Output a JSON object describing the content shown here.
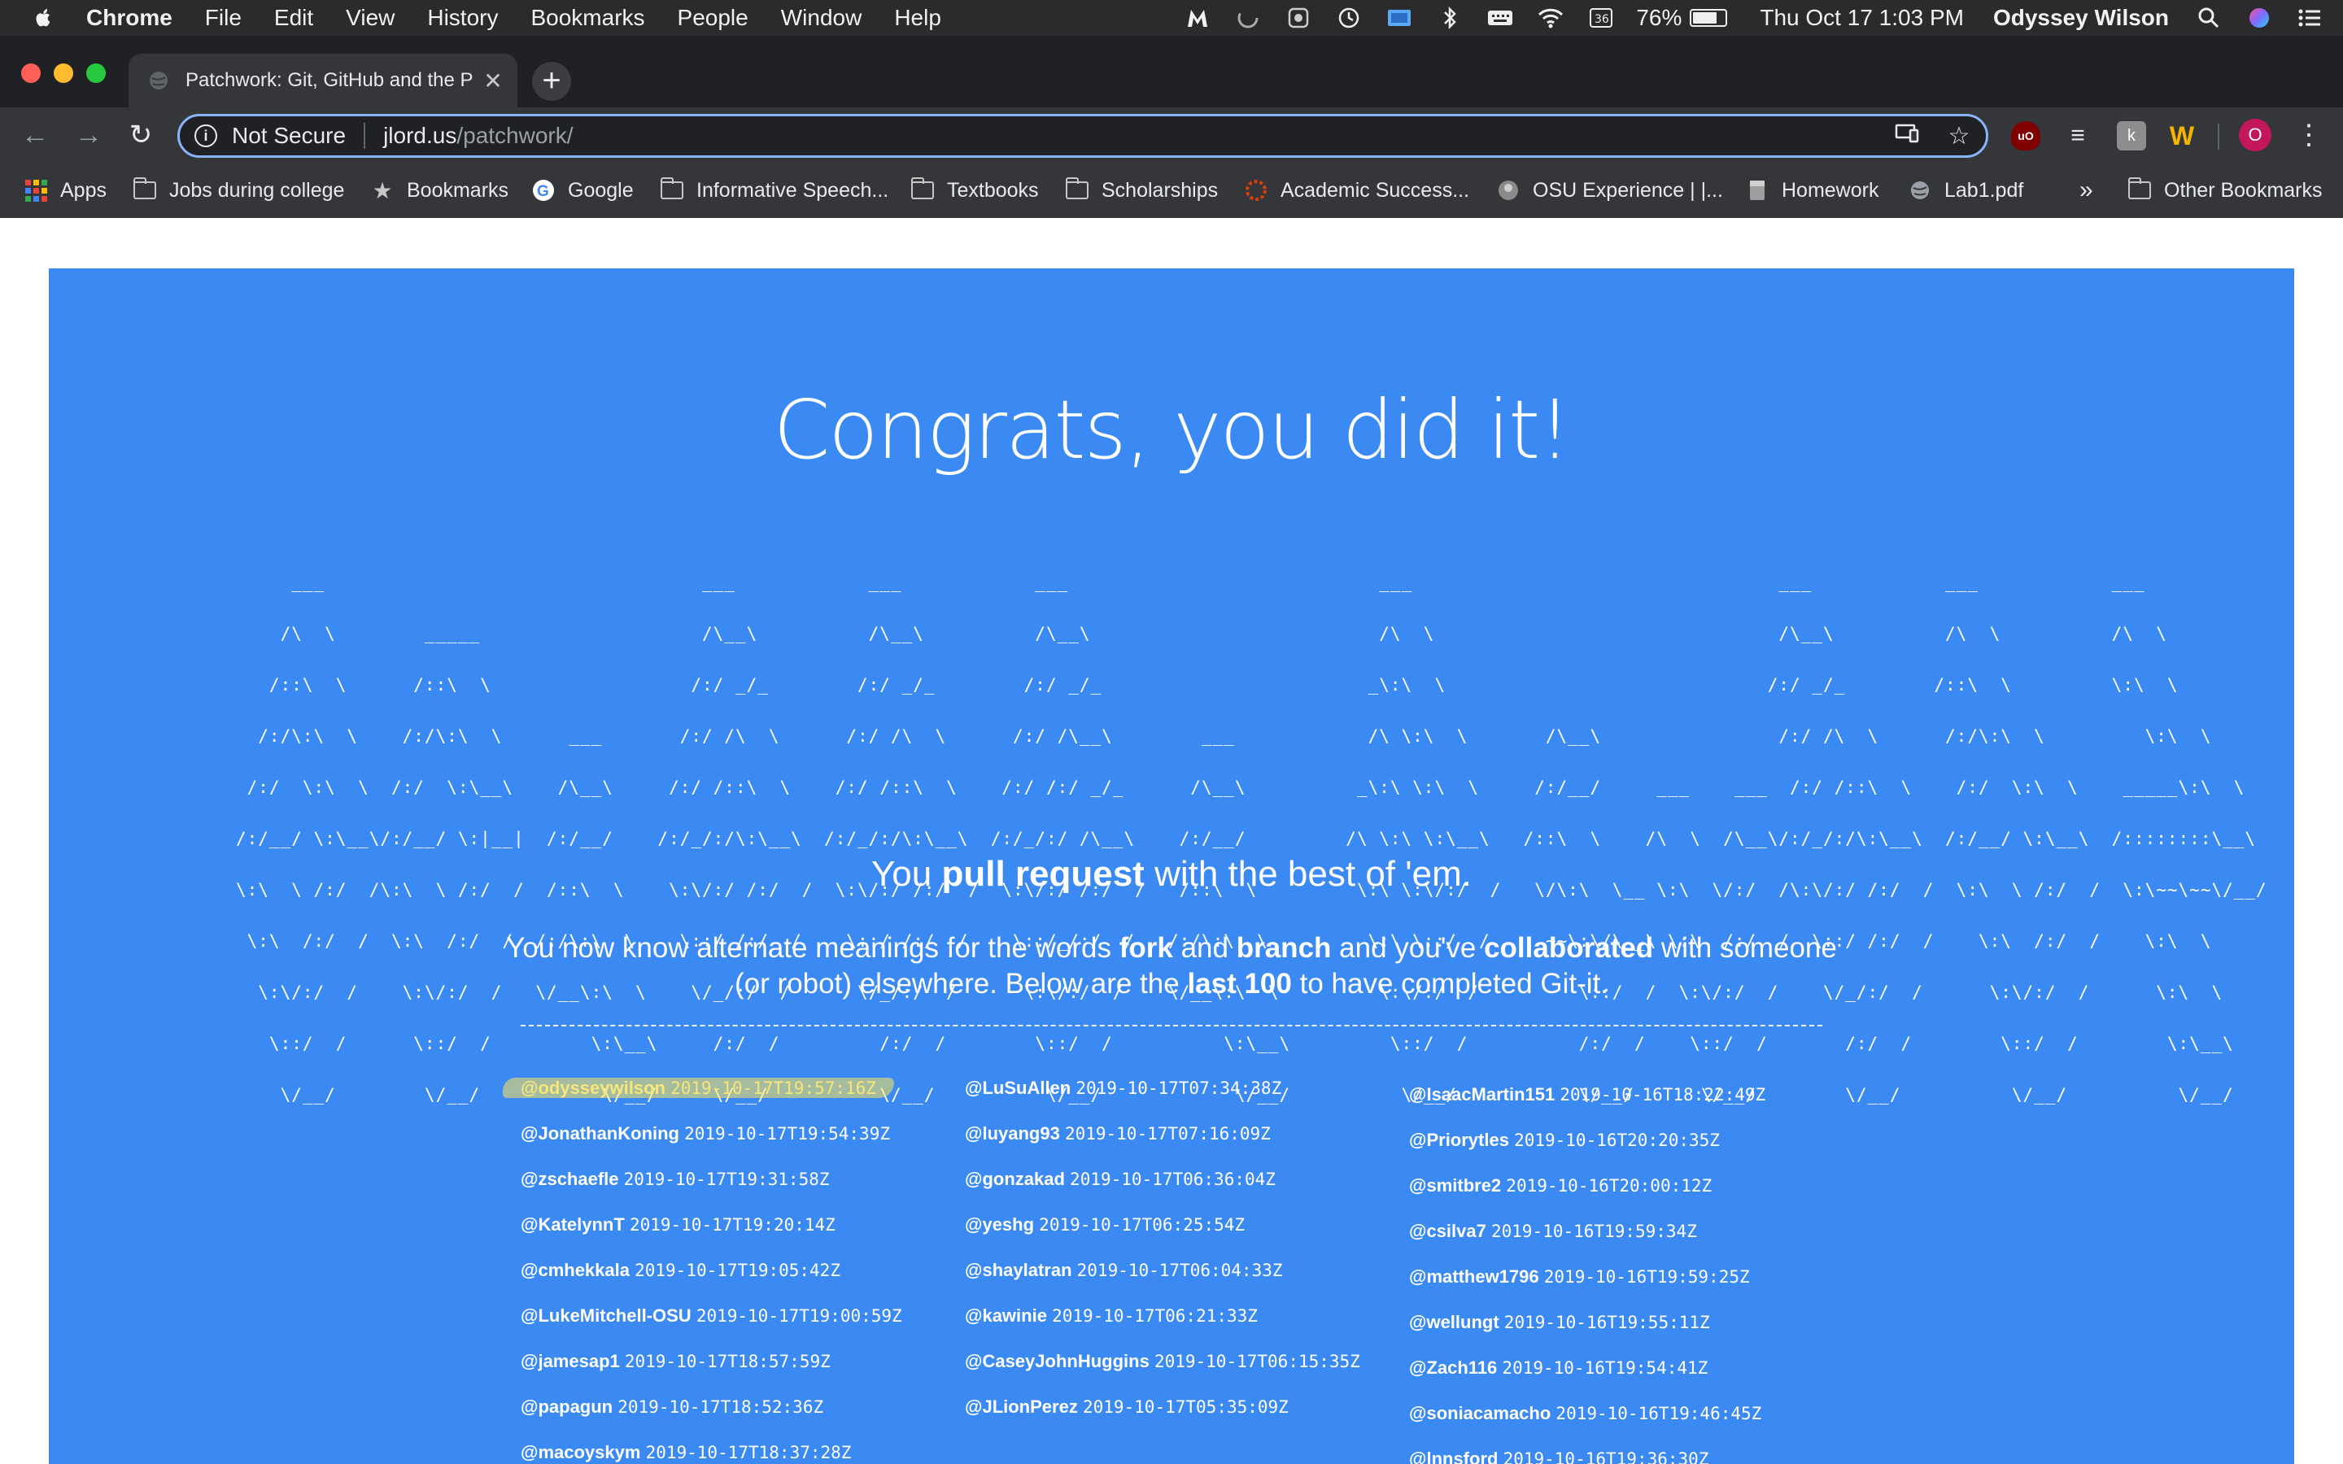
{
  "menubar": {
    "app_name": "Chrome",
    "menus": [
      "File",
      "Edit",
      "View",
      "History",
      "Bookmarks",
      "People",
      "Window",
      "Help"
    ],
    "battery": "76%",
    "battery_level": 0.76,
    "datetime": "Thu Oct 17  1:03 PM",
    "user": "Odyssey Wilson"
  },
  "browser": {
    "tab_title": "Patchwork: Git, GitHub and the P",
    "url_security": "Not Secure",
    "url_host": "jlord.us",
    "url_path": "/patchwork/",
    "profile_initial": "O",
    "ext_k": "k"
  },
  "bookmarks": {
    "items": [
      {
        "label": "Apps",
        "icon": "apps-grid-icon"
      },
      {
        "label": "Jobs during college",
        "icon": "folder-icon"
      },
      {
        "label": "Bookmarks",
        "icon": "star-icon"
      },
      {
        "label": "Google",
        "icon": "google-icon"
      },
      {
        "label": "Informative Speech...",
        "icon": "folder-icon"
      },
      {
        "label": "Textbooks",
        "icon": "folder-icon"
      },
      {
        "label": "Scholarships",
        "icon": "folder-icon"
      },
      {
        "label": "Academic Success...",
        "icon": "osu-icon"
      },
      {
        "label": "OSU Experience | |...",
        "icon": "osu-experience-icon"
      },
      {
        "label": "Homework",
        "icon": "document-icon"
      },
      {
        "label": "Lab1.pdf",
        "icon": "globe-icon"
      }
    ],
    "overflow": "»",
    "other": "Other Bookmarks"
  },
  "page": {
    "headline": "Congrats, you did it!",
    "ascii_art": [
      "     ___                                  ___            ___            ___                            ___                                 ___            ___            ___     ",
      "    /\\  \\        _____                    /\\__\\          /\\__\\          /\\__\\                          /\\  \\                               /\\__\\          /\\  \\          /\\  \\    ",
      "   /::\\  \\      /::\\  \\                  /:/ _/_        /:/ _/_        /:/ _/_                        _\\:\\  \\                             /:/ _/_        /::\\  \\         \\:\\  \\   ",
      "  /:/\\:\\  \\    /:/\\:\\  \\      ___       /:/ /\\  \\      /:/ /\\  \\      /:/ /\\__\\        ___            /\\ \\:\\  \\       /\\__\\                /:/ /\\  \\      /:/\\:\\  \\         \\:\\  \\  ",
      " /:/  \\:\\  \\  /:/  \\:\\__\\    /\\__\\     /:/ /::\\  \\    /:/ /::\\  \\    /:/ /:/ _/_      /\\__\\          _\\:\\ \\:\\  \\     /:/__/     ___    ___  /:/ /::\\  \\    /:/  \\:\\  \\    _____\\:\\  \\ ",
      "/:/__/ \\:\\__\\/:/__/ \\:|__|  /:/__/    /:/_/:/\\:\\__\\  /:/_/:/\\:\\__\\  /:/_/:/ /\\__\\    /:/__/         /\\ \\:\\ \\:\\__\\   /::\\  \\    /\\  \\  /\\__\\/:/_/:/\\:\\__\\  /:/__/ \\:\\__\\  /::::::::\\__\\",
      "\\:\\  \\ /:/  /\\:\\  \\ /:/  /  /::\\  \\    \\:\\/:/ /:/  /  \\:\\/:/ /:/  /  \\:\\/:/ /:/  /   /::\\  \\         \\:\\ \\:\\/:/  /   \\/\\:\\  \\__ \\:\\  \\/:/  /\\:\\/:/ /:/  /  \\:\\  \\ /:/  /  \\:\\~~\\~~\\/__/",
      " \\:\\  /:/  /  \\:\\  /:/  /  /:/\\:\\  \\    \\::/ /:/  /    \\::/ /:/  /    \\::/_/:/  /   /:/\\:\\  \\         \\:\\ \\::/  /     ~~\\:\\/\\__\\ \\:\\  /:/  /  \\::/ /:/  /    \\:\\  /:/  /    \\:\\  \\      ",
      "  \\:\\/:/  /    \\:\\/:/  /   \\/__\\:\\  \\    \\/_/:/  /      \\/_/:/  /      \\:\\/:/  /    \\/__\\:\\  \\         \\:\\/:/  /         \\::/  /  \\:\\/:/  /    \\/_/:/  /      \\:\\/:/  /      \\:\\  \\     ",
      "   \\::/  /      \\::/  /         \\:\\__\\     /:/  /         /:/  /        \\::/  /          \\:\\__\\         \\::/  /          /:/  /    \\::/  /       /:/  /        \\::/  /        \\:\\__\\    ",
      "    \\/__/        \\/__/           \\/__/     \\/__/          \\/__/          \\/__/            \\/__/          \\/__/           \\/__/      \\/__/        \\/__/          \\/__/          \\/__/    "
    ],
    "sub1_a": "You ",
    "sub1_b": "pull request",
    "sub1_c": " with the best of 'em.",
    "sub2_a": "You now know alternate meanings for the words ",
    "sub2_b": "fork",
    "sub2_c": " and ",
    "sub2_d": "branch",
    "sub2_e": " and you've ",
    "sub2_f": "collaborated",
    "sub2_g": " with someone (or robot) elsewhere. Below are the ",
    "sub2_h": "last 100",
    "sub2_i": " to have completed Git-it.",
    "columns": [
      [
        {
          "user": "@odysseywilson",
          "ts": "2019-10-17T19:57:16Z"
        },
        {
          "user": "@JonathanKoning",
          "ts": "2019-10-17T19:54:39Z"
        },
        {
          "user": "@zschaefle",
          "ts": "2019-10-17T19:31:58Z"
        },
        {
          "user": "@KatelynnT",
          "ts": "2019-10-17T19:20:14Z"
        },
        {
          "user": "@cmhekkala",
          "ts": "2019-10-17T19:05:42Z"
        },
        {
          "user": "@LukeMitchell-OSU",
          "ts": "2019-10-17T19:00:59Z"
        },
        {
          "user": "@jamesap1",
          "ts": "2019-10-17T18:57:59Z"
        },
        {
          "user": "@papagun",
          "ts": "2019-10-17T18:52:36Z"
        },
        {
          "user": "@macoyskym",
          "ts": "2019-10-17T18:37:28Z"
        }
      ],
      [
        {
          "user": "@LuSuAllen",
          "ts": "2019-10-17T07:34:38Z"
        },
        {
          "user": "@luyang93",
          "ts": "2019-10-17T07:16:09Z"
        },
        {
          "user": "@gonzakad",
          "ts": "2019-10-17T06:36:04Z"
        },
        {
          "user": "@yeshg",
          "ts": "2019-10-17T06:25:54Z"
        },
        {
          "user": "@shaylatran",
          "ts": "2019-10-17T06:04:33Z"
        },
        {
          "user": "@kawinie",
          "ts": "2019-10-17T06:21:33Z"
        },
        {
          "user": "@CaseyJohnHuggins",
          "ts": "2019-10-17T06:15:35Z"
        },
        {
          "user": "@JLionPerez",
          "ts": "2019-10-17T05:35:09Z"
        }
      ],
      [
        {
          "user": "@IsaacMartin151",
          "ts": "2019-10-16T18:22:49Z"
        },
        {
          "user": "@Priorytles",
          "ts": "2019-10-16T20:20:35Z"
        },
        {
          "user": "@smitbre2",
          "ts": "2019-10-16T20:00:12Z"
        },
        {
          "user": "@csilva7",
          "ts": "2019-10-16T19:59:34Z"
        },
        {
          "user": "@matthew1796",
          "ts": "2019-10-16T19:59:25Z"
        },
        {
          "user": "@wellungt",
          "ts": "2019-10-16T19:55:11Z"
        },
        {
          "user": "@Zach116",
          "ts": "2019-10-16T19:54:41Z"
        },
        {
          "user": "@soniacamacho",
          "ts": "2019-10-16T19:46:45Z"
        },
        {
          "user": "@lnnsford",
          "ts": "2019-10-16T19:36:30Z"
        }
      ]
    ]
  },
  "colors": {
    "page_blue": "#3b8af4",
    "highlight": "#f7e67a",
    "chrome_dark": "#202124",
    "chrome_toolbar": "#35363a"
  }
}
